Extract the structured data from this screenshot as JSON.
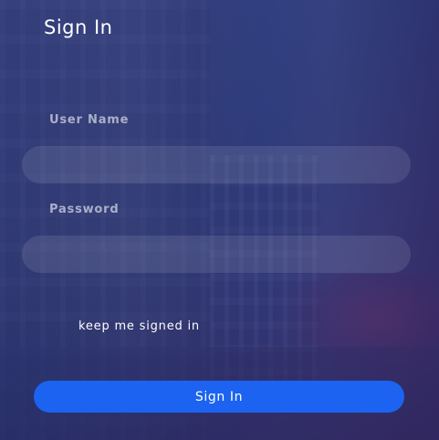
{
  "title": "Sign In",
  "form": {
    "username_label": "User Name",
    "username_value": "",
    "password_label": "Password",
    "password_value": "",
    "keep_signed_in_label": "keep me signed in",
    "keep_signed_in_checked": false,
    "submit_label": "Sign In"
  },
  "colors": {
    "overlay_tint": "#2f3d86",
    "button": "#1b63f0",
    "label": "#aab0c8",
    "text": "#ffffff"
  }
}
